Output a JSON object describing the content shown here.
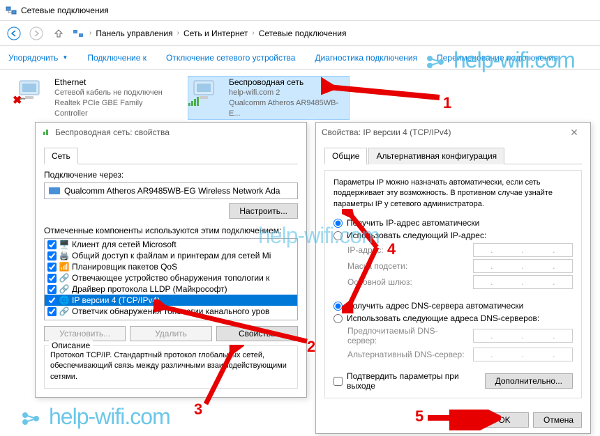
{
  "window": {
    "title": "Сетевые подключения"
  },
  "breadcrumb": {
    "item1": "Панель управления",
    "item2": "Сеть и Интернет",
    "item3": "Сетевые подключения"
  },
  "toolbar": {
    "organize": "Упорядочить",
    "connect": "Подключение к",
    "disable": "Отключение сетевого устройства",
    "diagnose": "Диагностика подключения",
    "rename": "Переименование подключения"
  },
  "adapters": {
    "ethernet": {
      "name": "Ethernet",
      "status": "Сетевой кабель не подключен",
      "device": "Realtek PCIe GBE Family Controller"
    },
    "wifi": {
      "name": "Беспроводная сеть",
      "status": "help-wifi.com  2",
      "device": "Qualcomm Atheros AR9485WB-E..."
    }
  },
  "props_dialog": {
    "title": "Беспроводная сеть: свойства",
    "tab_network": "Сеть",
    "connect_via": "Подключение через:",
    "adapter": "Qualcomm Atheros AR9485WB-EG Wireless Network Ada",
    "configure_btn": "Настроить...",
    "components_label": "Отмеченные компоненты используются этим подключением:",
    "components": [
      "Клиент для сетей Microsoft",
      "Общий доступ к файлам и принтерам для сетей Mi",
      "Планировщик пакетов QoS",
      "Отвечающее устройство обнаружения топологии к",
      "Драйвер протокола LLDP (Майкрософт)",
      "IP версии 4 (TCP/IPv4)",
      "Ответчик обнаружения топологии канального уров"
    ],
    "install_btn": "Установить...",
    "remove_btn": "Удалить",
    "props_btn": "Свойства",
    "desc_title": "Описание",
    "desc_text": "Протокол TCP/IP. Стандартный протокол глобальных сетей, обеспечивающий связь между различными взаимодействующими сетями."
  },
  "ipv4_dialog": {
    "title": "Свойства: IP версии 4 (TCP/IPv4)",
    "tab_general": "Общие",
    "tab_alt": "Альтернативная конфигурация",
    "intro": "Параметры IP можно назначать автоматически, если сеть поддерживает эту возможность. В противном случае узнайте параметры IP у сетевого администратора.",
    "auto_ip": "Получить IP-адрес автоматически",
    "manual_ip": "Использовать следующий IP-адрес:",
    "ip_label": "IP-адрес:",
    "mask_label": "Маска подсети:",
    "gateway_label": "Основной шлюз:",
    "auto_dns": "Получить адрес DNS-сервера автоматически",
    "manual_dns": "Использовать следующие адреса DNS-серверов:",
    "dns1_label": "Предпочитаемый DNS-сервер:",
    "dns2_label": "Альтернативный DNS-сервер:",
    "validate": "Подтвердить параметры при выходе",
    "advanced_btn": "Дополнительно...",
    "ok_btn": "OK",
    "cancel_btn": "Отмена"
  },
  "annotations": {
    "n1": "1",
    "n2": "2",
    "n3": "3",
    "n4": "4",
    "n5": "5"
  },
  "watermark": "help-wifi.com"
}
